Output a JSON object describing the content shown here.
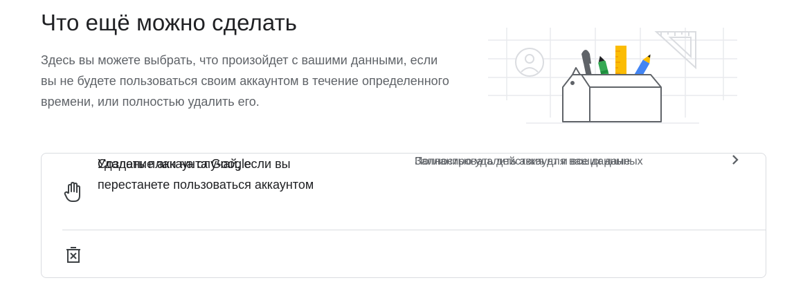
{
  "section": {
    "title": "Что ещё можно сделать",
    "description": "Здесь вы можете выбрать, что произойдет с вашими данными, если вы не будете пользоваться своим аккаунтом в течение определенного времени, или полностью удалить его."
  },
  "options": [
    {
      "icon": "hand-icon",
      "title": "Создать план на случай, если вы перестанете пользоваться аккаунтом",
      "description": "Запланировать действия для ваших данных"
    },
    {
      "icon": "delete-box-icon",
      "title": "Удаление аккаунта Google",
      "description": "Полностью удалить аккаунт и все данные"
    }
  ],
  "colors": {
    "text_primary": "#202124",
    "text_secondary": "#5f6368",
    "border": "#dadce0",
    "illustration_yellow": "#fbbc04",
    "illustration_green": "#34a853",
    "illustration_red": "#ea4335",
    "illustration_blue": "#4285f4"
  }
}
